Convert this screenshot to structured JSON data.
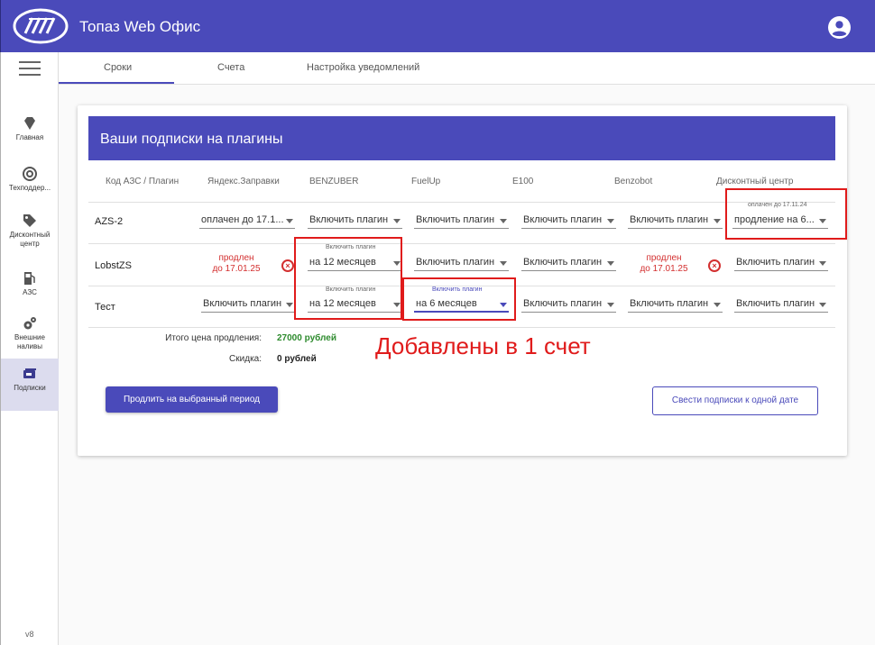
{
  "app": {
    "title": "Топаз Web Офис",
    "version": "v8"
  },
  "sidebar": {
    "items": [
      {
        "label": "Главная",
        "icon": "diamond-icon"
      },
      {
        "label": "Техподдер...",
        "icon": "lifebuoy-icon"
      },
      {
        "label": "Дисконтный центр",
        "icon": "tag-icon"
      },
      {
        "label": "АЗС",
        "icon": "fuel-pump-icon"
      },
      {
        "label": "Внешние наливы",
        "icon": "gears-icon"
      },
      {
        "label": "Подписки",
        "icon": "subscriptions-icon"
      }
    ]
  },
  "tabs": [
    {
      "label": "Сроки"
    },
    {
      "label": "Счета"
    },
    {
      "label": "Настройка уведомлений"
    }
  ],
  "card": {
    "title": "Ваши подписки на плагины",
    "columns": [
      "Код АЗС / Плагин",
      "Яндекс.Заправки",
      "BENZUBER",
      "FuelUp",
      "E100",
      "Benzobot",
      "Дисконтный центр"
    ],
    "rows": [
      {
        "name": "AZS-2",
        "cells": [
          {
            "value": "оплачен до 17.1..."
          },
          {
            "value": "Включить плагин"
          },
          {
            "value": "Включить плагин"
          },
          {
            "value": "Включить плагин"
          },
          {
            "value": "Включить плагин"
          },
          {
            "label": "оплачен до 17.11.24",
            "value": "продление на 6..."
          }
        ]
      },
      {
        "name": "LobstZS",
        "cells": [
          {
            "renewed_line1": "продлен",
            "renewed_line2": "до 17.01.25"
          },
          {
            "label": "Включить плагин",
            "value": "на 12 месяцев"
          },
          {
            "value": "Включить плагин"
          },
          {
            "value": "Включить плагин"
          },
          {
            "renewed_line1": "продлен",
            "renewed_line2": "до 17.01.25"
          },
          {
            "value": "Включить плагин"
          }
        ]
      },
      {
        "name": "Тест",
        "cells": [
          {
            "value": "Включить плагин"
          },
          {
            "label": "Включить плагин",
            "value": "на 12 месяцев"
          },
          {
            "label": "Включить плагин",
            "value": "на 6 месяцев"
          },
          {
            "value": "Включить плагин"
          },
          {
            "value": "Включить плагин"
          },
          {
            "value": "Включить плагин"
          }
        ]
      }
    ],
    "summary": {
      "total_label": "Итого цена продления:",
      "total_value": "27000 рублей",
      "discount_label": "Скидка:",
      "discount_value": "0 рублей"
    },
    "buttons": {
      "renew": "Продлить на выбранный период",
      "align": "Свести подписки к одной дате"
    }
  },
  "annotation": {
    "text": "Добавлены в 1 счет"
  },
  "colors": {
    "primary": "#4a4aba",
    "danger": "#d32f2f",
    "success": "#2e8b2e",
    "highlight": "#e01b1b"
  }
}
